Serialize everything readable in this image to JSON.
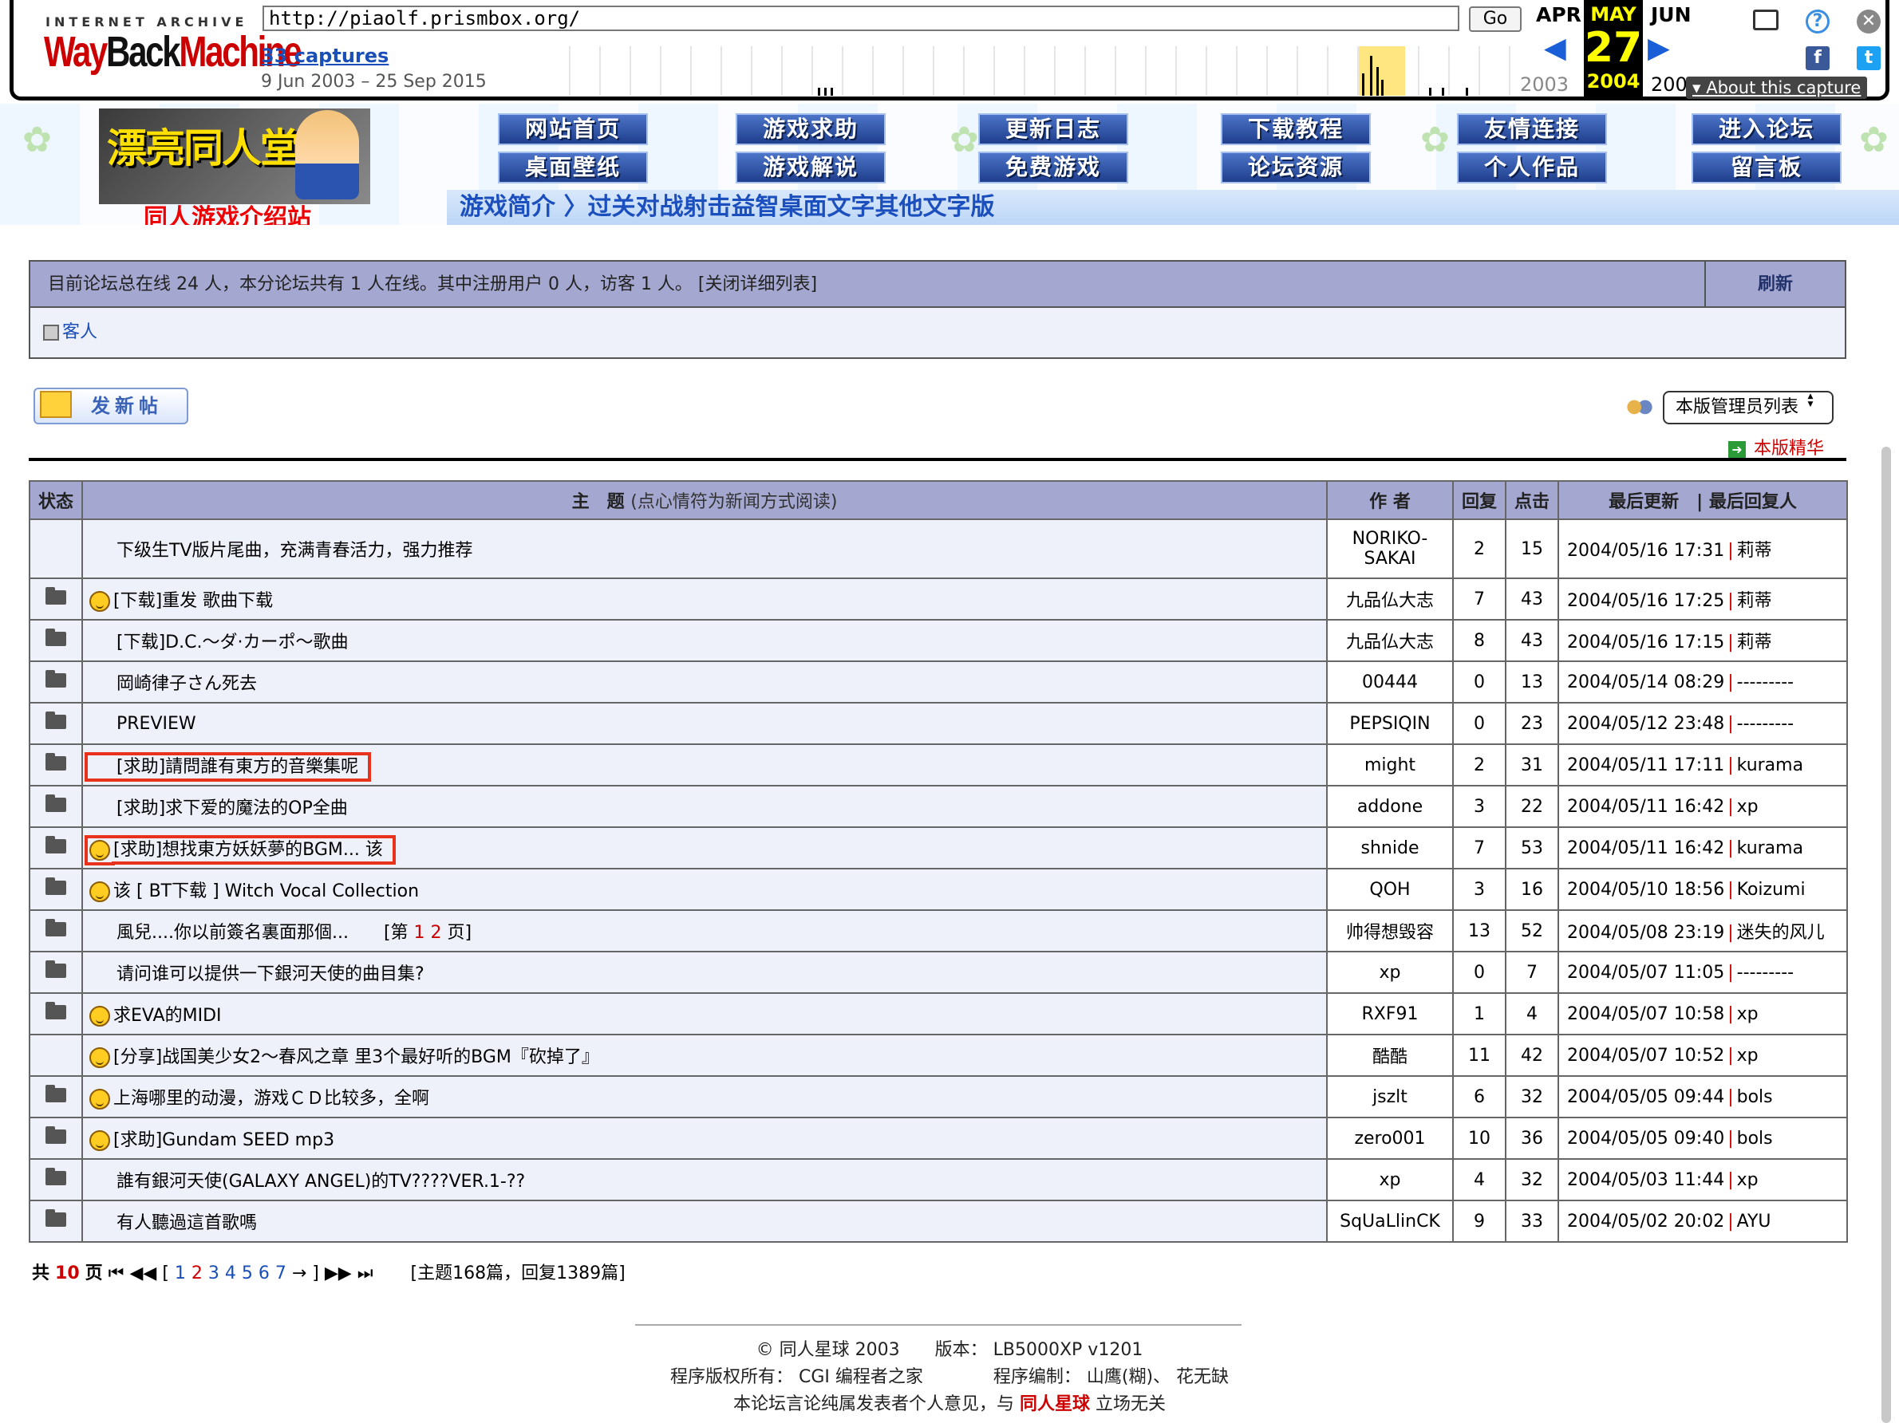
{
  "wayback": {
    "logo_top": "INTERNET ARCHIVE",
    "logo_way": "Way",
    "logo_back": "Back",
    "logo_machine": "Machine",
    "url": "http://piaolf.prismbox.org/",
    "go_label": "Go",
    "captures": "33 captures",
    "range": "9 Jun 2003 – 25 Sep 2015",
    "prev_month": "APR",
    "cur_month": "MAY",
    "next_month": "JUN",
    "day": "27",
    "prev_year": "2003",
    "cur_year": "2004",
    "next_year": "200",
    "about": "▾ About this capture",
    "colors": {
      "accent": "#1a5fd8",
      "highlight": "#ffff00"
    }
  },
  "banner": {
    "logo_text": "漂亮同人堂",
    "nav_row1": [
      "网站首页",
      "游戏求助",
      "更新日志",
      "下载教程",
      "友情连接",
      "进入论坛"
    ],
    "nav_row2": [
      "桌面壁纸",
      "游戏解说",
      "免费游戏",
      "论坛资源",
      "个人作品",
      "留言板"
    ],
    "site_title": "同人游戏介绍站",
    "category_strip": "游戏简介 〉过关对战射击益智桌面文字其他文字版"
  },
  "online": {
    "summary": "目前论坛总在线 24 人，本分论坛共有 1 人在线。其中注册用户 0 人，访客 1 人。   [关闭详细列表]",
    "refresh": "刷新",
    "guest": "客人"
  },
  "actions": {
    "new_post": "发新帖",
    "moderators_select": "本版管理员列表",
    "essence_link": "本版精华"
  },
  "table": {
    "headers": {
      "status": "状态",
      "topic": "主　题",
      "topic_hint": "(点心情符为新闻方式阅读)",
      "author": "作 者",
      "replies": "回复",
      "clicks": "点击",
      "last_update": "最后更新",
      "last_replier": "| 最后回复人"
    },
    "rows": [
      {
        "folder": false,
        "mood": false,
        "title": "下级生TV版片尾曲，充满青春活力，强力推荐",
        "author": "NORIKO-SAKAI",
        "replies": "2",
        "clicks": "15",
        "updated": "2004/05/16 17:31",
        "last": "莉蒂"
      },
      {
        "folder": true,
        "mood": true,
        "title": "[下载]重发 歌曲下载",
        "author": "九品仏大志",
        "replies": "7",
        "clicks": "43",
        "updated": "2004/05/16 17:25",
        "last": "莉蒂"
      },
      {
        "folder": true,
        "mood": false,
        "title": "[下载]D.C.～ダ·カーポ～歌曲",
        "author": "九品仏大志",
        "replies": "8",
        "clicks": "43",
        "updated": "2004/05/16 17:15",
        "last": "莉蒂"
      },
      {
        "folder": true,
        "mood": false,
        "title": "岡崎律子さん死去",
        "author": "00444",
        "replies": "0",
        "clicks": "13",
        "updated": "2004/05/14 08:29",
        "last": "---------"
      },
      {
        "folder": true,
        "mood": false,
        "title": "PREVIEW",
        "author": "PEPSIQIN",
        "replies": "0",
        "clicks": "23",
        "updated": "2004/05/12 23:48",
        "last": "---------"
      },
      {
        "folder": true,
        "mood": false,
        "title": "[求助]請問誰有東方的音樂集呢",
        "author": "might",
        "replies": "2",
        "clicks": "31",
        "updated": "2004/05/11 17:11",
        "last": "kurama",
        "boxed": true
      },
      {
        "folder": true,
        "mood": false,
        "title": "[求助]求下爱的魔法的OP全曲",
        "author": "addone",
        "replies": "3",
        "clicks": "22",
        "updated": "2004/05/11 16:42",
        "last": "xp"
      },
      {
        "folder": true,
        "mood": true,
        "title": "[求助]想找東方妖妖夢的BGM... 该",
        "author": "shnide",
        "replies": "7",
        "clicks": "53",
        "updated": "2004/05/11 16:42",
        "last": "kurama",
        "boxed": true
      },
      {
        "folder": true,
        "mood": true,
        "title": "该 [ BT下载 ] Witch Vocal Collection",
        "author": "QOH",
        "replies": "3",
        "clicks": "16",
        "updated": "2004/05/10 18:56",
        "last": "Koizumi"
      },
      {
        "folder": true,
        "mood": false,
        "title": "風兒....你以前簽名裏面那個...",
        "pages_prefix": "[第",
        "pages": "1 2",
        "pages_suffix": "页]",
        "author": "帅得想毁容",
        "replies": "13",
        "clicks": "52",
        "updated": "2004/05/08 23:19",
        "last": "迷失的风儿"
      },
      {
        "folder": true,
        "mood": false,
        "title": "请问谁可以提供一下銀河天使的曲目集?",
        "author": "xp",
        "replies": "0",
        "clicks": "7",
        "updated": "2004/05/07 11:05",
        "last": "---------"
      },
      {
        "folder": true,
        "mood": true,
        "title": "求EVA的MIDI",
        "author": "RXF91",
        "replies": "1",
        "clicks": "4",
        "updated": "2004/05/07 10:58",
        "last": "xp"
      },
      {
        "folder": false,
        "mood": true,
        "title": "[分享]战国美少女2～春风之章 里3个最好听的BGM『砍掉了』",
        "author": "酷酷",
        "replies": "11",
        "clicks": "42",
        "updated": "2004/05/07 10:52",
        "last": "xp"
      },
      {
        "folder": true,
        "mood": true,
        "title": "上海哪里的动漫，游戏ＣＤ比较多，全啊",
        "author": "jszlt",
        "replies": "6",
        "clicks": "32",
        "updated": "2004/05/05 09:44",
        "last": "bols"
      },
      {
        "folder": true,
        "mood": true,
        "title": "[求助]Gundam SEED mp3",
        "author": "zero001",
        "replies": "10",
        "clicks": "36",
        "updated": "2004/05/05 09:40",
        "last": "bols"
      },
      {
        "folder": true,
        "mood": false,
        "title": "誰有銀河天使(GALAXY ANGEL)的TV????VER.1-??",
        "author": "xp",
        "replies": "4",
        "clicks": "32",
        "updated": "2004/05/03 11:44",
        "last": "xp"
      },
      {
        "folder": true,
        "mood": false,
        "title": "有人聽過這首歌嗎",
        "author": "SqUaLlinCK",
        "replies": "9",
        "clicks": "33",
        "updated": "2004/05/02 20:02",
        "last": "AYU"
      }
    ]
  },
  "pager": {
    "prefix": "共",
    "total_pages": "10",
    "suffix": "页",
    "nav_first": "⏮",
    "nav_prev": "◀◀",
    "pages_open": "[",
    "page_1": "1",
    "current": "2",
    "pages_rest": "3 4 5 6 7",
    "pages_close": "→ ]",
    "nav_next": "▶▶",
    "nav_last": "⏭",
    "stats": "[主题168篇，回复1389篇]"
  },
  "footer": {
    "copyright": "© 同人星球 2003　　版本：",
    "version": "LB5000XP v1201",
    "owner_label": "程序版权所有：",
    "owner": "CGI 编程者之家",
    "dev_label": "程序编制：",
    "dev": "山鹰(糊)、 花无缺",
    "disclaimer_pre": "本论坛言论纯属发表者个人意见，与",
    "disclaimer_brand": "同人星球",
    "disclaimer_post": "立场无关"
  }
}
